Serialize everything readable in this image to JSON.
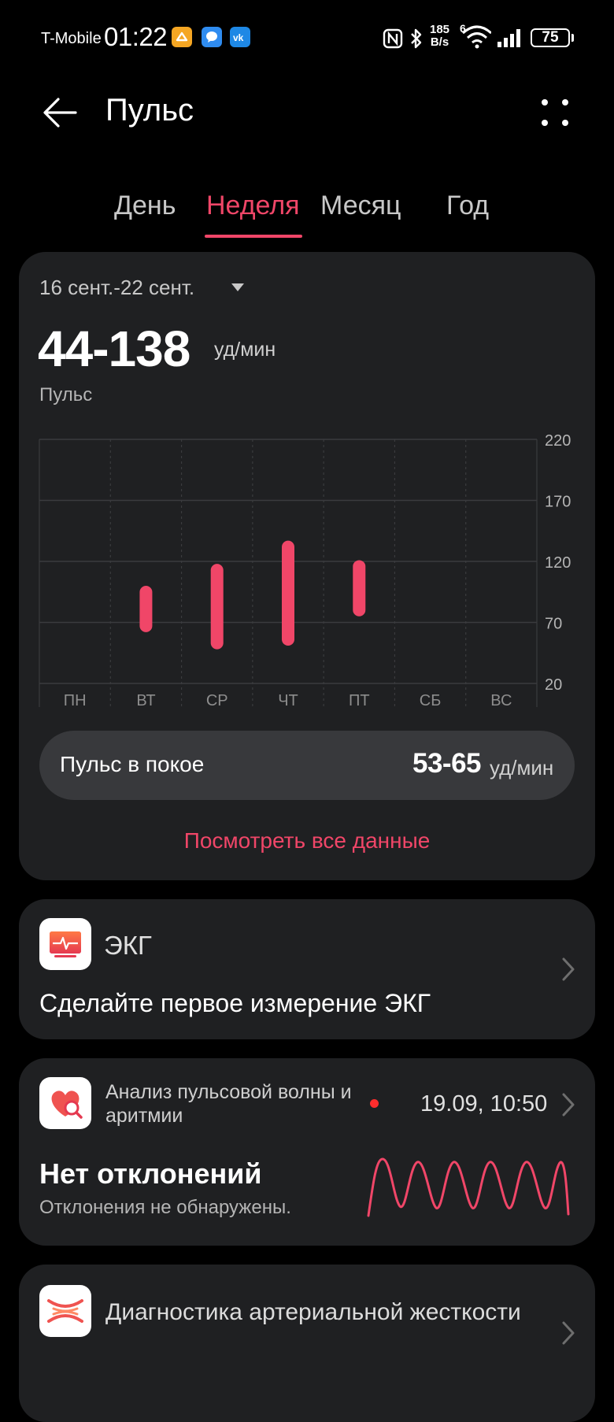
{
  "status_bar": {
    "carrier": "T-Mobile",
    "time": "01:22",
    "net_speed_top": "185",
    "net_speed_bottom": "B/s",
    "wifi_badge": "6",
    "battery": "75"
  },
  "header": {
    "title": "Пульс"
  },
  "tabs": [
    {
      "label": "День",
      "active": false
    },
    {
      "label": "Неделя",
      "active": true
    },
    {
      "label": "Месяц",
      "active": false
    },
    {
      "label": "Год",
      "active": false
    }
  ],
  "summary": {
    "date_range": "16 сент.-22 сент.",
    "range_value": "44-138",
    "unit": "уд/мин",
    "label": "Пульс"
  },
  "chart_data": {
    "type": "bar",
    "subtype": "range",
    "categories": [
      "ПН",
      "ВТ",
      "СР",
      "ЧТ",
      "ПТ",
      "СБ",
      "ВС"
    ],
    "series": [
      {
        "low": [
          null,
          62,
          48,
          51,
          75,
          null,
          null
        ],
        "high": [
          null,
          100,
          118,
          137,
          121,
          null,
          null
        ]
      }
    ],
    "y_ticks": [
      220,
      170,
      120,
      70,
      20
    ],
    "ylim": [
      20,
      220
    ],
    "y_axis_position": "right",
    "grid": true,
    "bar_color": "#f04668"
  },
  "resting": {
    "label": "Пульс в покое",
    "value": "53-65",
    "unit": "уд/мин"
  },
  "see_all": "Посмотреть все данные",
  "ecg": {
    "name": "ЭКГ",
    "message": "Сделайте первое измерение ЭКГ"
  },
  "pulse_wave": {
    "title": "Анализ пульсовой волны и аритмии",
    "datetime": "19.09, 10:50",
    "status": "Нет отклонений",
    "subtitle": "Отклонения не обнаружены."
  },
  "arterial": {
    "title": "Диагностика артериальной жесткости"
  },
  "colors": {
    "accent": "#f04668",
    "card": "#1f2022",
    "background": "#000000"
  }
}
